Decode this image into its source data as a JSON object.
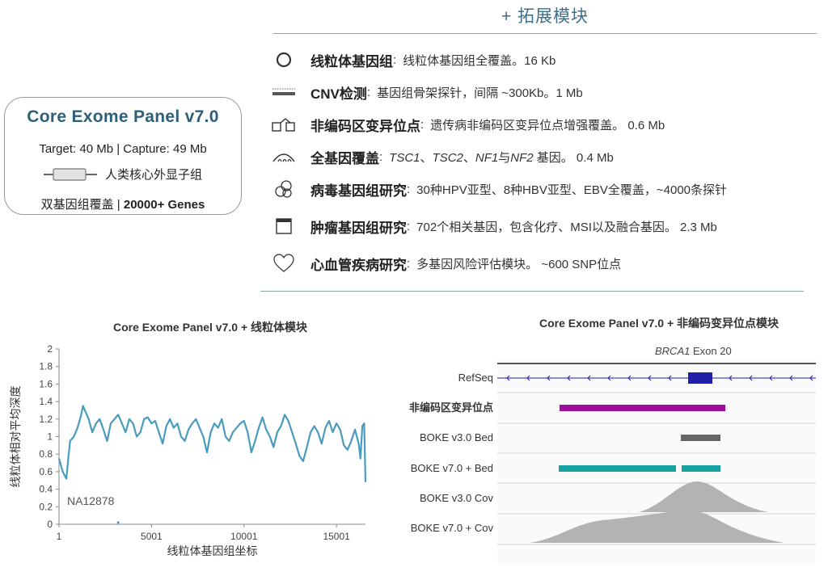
{
  "modules": {
    "header": "+ 拓展模块",
    "items": [
      {
        "icon": "circle-icon",
        "name": "线粒体基因组",
        "sep": ":",
        "desc": "线粒体基因组全覆盖。16 Kb"
      },
      {
        "icon": "dotted-bar-icon",
        "name": "CNV检测",
        "sep": ":",
        "desc": "基因组骨架探针，间隔 ~300Kb。1 Mb"
      },
      {
        "icon": "noncoding-icon",
        "name": "非编码区变异位点",
        "sep": ":",
        "desc": "遗传病非编码区变异位点增强覆盖。 0.6 Mb"
      },
      {
        "icon": "arch-icon",
        "name": "全基因覆盖",
        "sep": ":",
        "desc_parts": [
          "TSC1",
          "、",
          "TSC2",
          "、",
          "NF1",
          "与",
          "NF2",
          " 基因。 0.4 Mb"
        ]
      },
      {
        "icon": "virus-icon",
        "name": "病毒基因组研究",
        "sep": ":",
        "desc": "30种HPV亚型、8种HBV亚型、EBV全覆盖，~4000条探针"
      },
      {
        "icon": "window-icon",
        "name": "肿瘤基因组研究",
        "sep": ":",
        "desc": "702个相关基因，包含化疗、MSI以及融合基因。 2.3 Mb"
      },
      {
        "icon": "heart-icon",
        "name": "心血管疾病研究",
        "sep": ":",
        "desc": "多基因风险评估模块。 ~600 SNP位点"
      }
    ]
  },
  "panel": {
    "title": "Core Exome Panel v7.0",
    "target": "Target: 40 Mb | Capture: 49 Mb",
    "legend": "人类核心外显子组",
    "footer_prefix": "双基因组覆盖 | ",
    "footer_bold": "20000+ Genes"
  },
  "chart_data": [
    {
      "type": "line",
      "title": "Core Exome Panel v7.0 + 线粒体模块",
      "xlabel": "线粒体基因组坐标",
      "ylabel": "线粒体相对平均深度",
      "xlim": [
        1,
        16569
      ],
      "ylim": [
        0,
        2
      ],
      "xticks": [
        "1",
        "5001",
        "10001",
        "15001"
      ],
      "yticks": [
        "0",
        "0.2",
        "0.4",
        "0.6",
        "0.8",
        "1",
        "1.2",
        "1.4",
        "1.6",
        "1.8",
        "2"
      ],
      "annotation": "NA12878",
      "color": "#4a9bbd",
      "series": [
        {
          "x": [
            1,
            200,
            400,
            500,
            600,
            800,
            1000,
            1200,
            1300,
            1400,
            1600,
            1800,
            2000,
            2200,
            2400,
            2600,
            2800,
            3000,
            3200,
            3400,
            3600,
            3800,
            4000,
            4200,
            4400,
            4600,
            4800,
            5000,
            5200,
            5400,
            5600,
            5800,
            6000,
            6200,
            6400,
            6600,
            6800,
            7000,
            7200,
            7400,
            7600,
            7800,
            8000,
            8200,
            8400,
            8600,
            8800,
            9000,
            9200,
            9400,
            9600,
            9800,
            10000,
            10200,
            10400,
            10600,
            10800,
            11000,
            11200,
            11400,
            11600,
            11800,
            12000,
            12200,
            12400,
            12600,
            12800,
            13000,
            13200,
            13400,
            13600,
            13800,
            14000,
            14200,
            14400,
            14600,
            14800,
            15000,
            15200,
            15400,
            15600,
            15800,
            16000,
            16200,
            16300,
            16400,
            16500,
            16569
          ],
          "y": [
            0.75,
            0.6,
            0.52,
            0.75,
            0.95,
            1.0,
            1.1,
            1.25,
            1.35,
            1.3,
            1.2,
            1.05,
            1.15,
            1.2,
            1.08,
            0.95,
            1.15,
            1.2,
            1.25,
            1.15,
            1.05,
            1.2,
            1.15,
            1.0,
            1.05,
            1.2,
            1.22,
            1.15,
            1.18,
            1.05,
            0.92,
            1.12,
            1.2,
            1.1,
            1.15,
            1.0,
            0.95,
            1.08,
            1.15,
            1.2,
            1.1,
            1.0,
            0.82,
            1.05,
            1.15,
            1.1,
            1.2,
            1.0,
            0.95,
            1.05,
            1.1,
            1.15,
            1.18,
            1.05,
            0.82,
            0.95,
            1.1,
            1.22,
            1.08,
            1.0,
            0.88,
            1.05,
            1.12,
            1.25,
            1.18,
            1.05,
            0.92,
            0.78,
            0.72,
            0.88,
            1.05,
            1.12,
            1.05,
            0.92,
            1.1,
            1.18,
            1.05,
            1.15,
            1.08,
            0.9,
            0.85,
            0.95,
            1.08,
            0.92,
            0.75,
            1.12,
            1.15,
            0.48
          ]
        }
      ]
    },
    {
      "type": "area",
      "title": "Core Exome Panel v7.0 + 非编码变异位点模块",
      "region_label_gene": "BRCA1",
      "region_label_rest": " Exon 20",
      "tracks": [
        "RefSeq",
        "非编码区变异位点",
        "BOKE v3.0 Bed",
        "BOKE v7.0 + Bed",
        "BOKE v3.0 Cov",
        "BOKE v7.0 + Cov"
      ],
      "colors": {
        "refseq": "#1f1fa8",
        "noncoding": "#9b0f9b",
        "bed3": "#666666",
        "bed7": "#16a3a0",
        "coverage": "#b3b3b3"
      }
    }
  ]
}
